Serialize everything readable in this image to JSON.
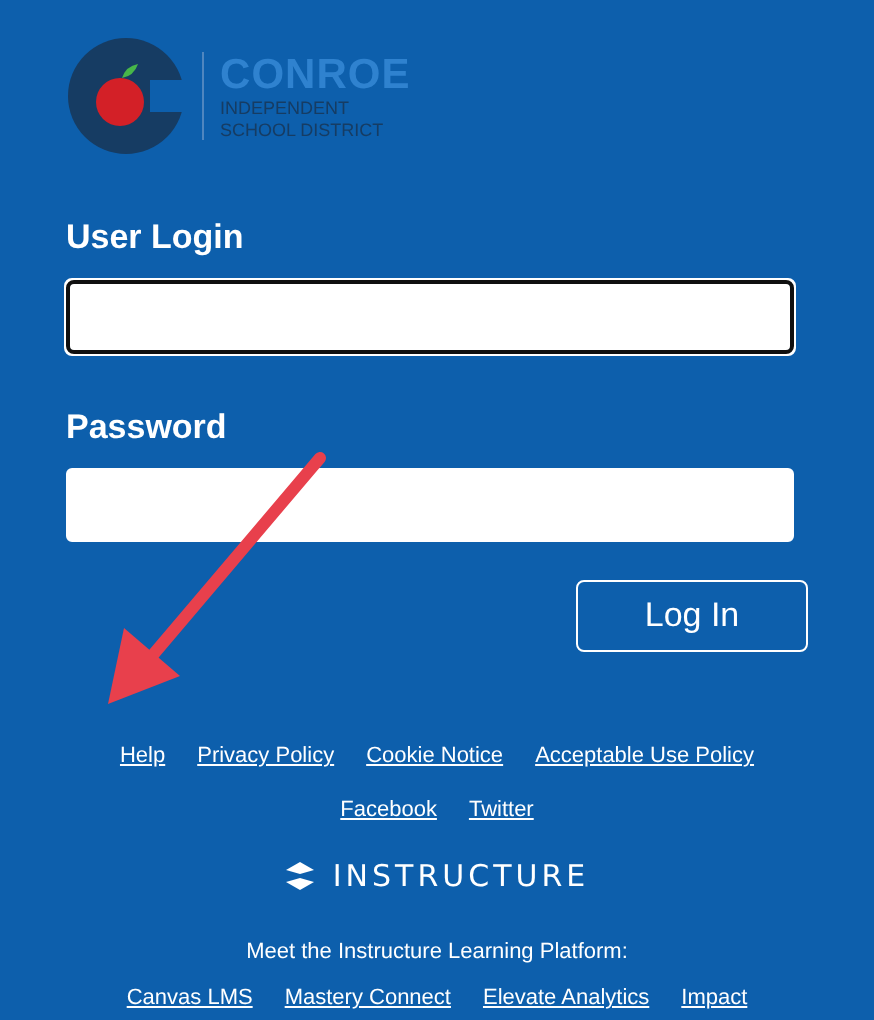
{
  "logo": {
    "name": "CONROE",
    "subtitle_lines": [
      "INDEPENDENT",
      "SCHOOL DISTRICT"
    ]
  },
  "fields": [
    {
      "label": "User Login",
      "focused": true
    },
    {
      "label": "Password",
      "focused": false
    }
  ],
  "login_button": "Log In",
  "footer_links": [
    "Help",
    "Privacy Policy",
    "Cookie Notice",
    "Acceptable Use Policy"
  ],
  "social_links": [
    "Facebook",
    "Twitter"
  ],
  "brand": "INSTRUCTURE",
  "platform_text": "Meet the Instructure Learning Platform:",
  "platform_links": [
    "Canvas LMS",
    "Mastery Connect",
    "Elevate Analytics",
    "Impact"
  ]
}
